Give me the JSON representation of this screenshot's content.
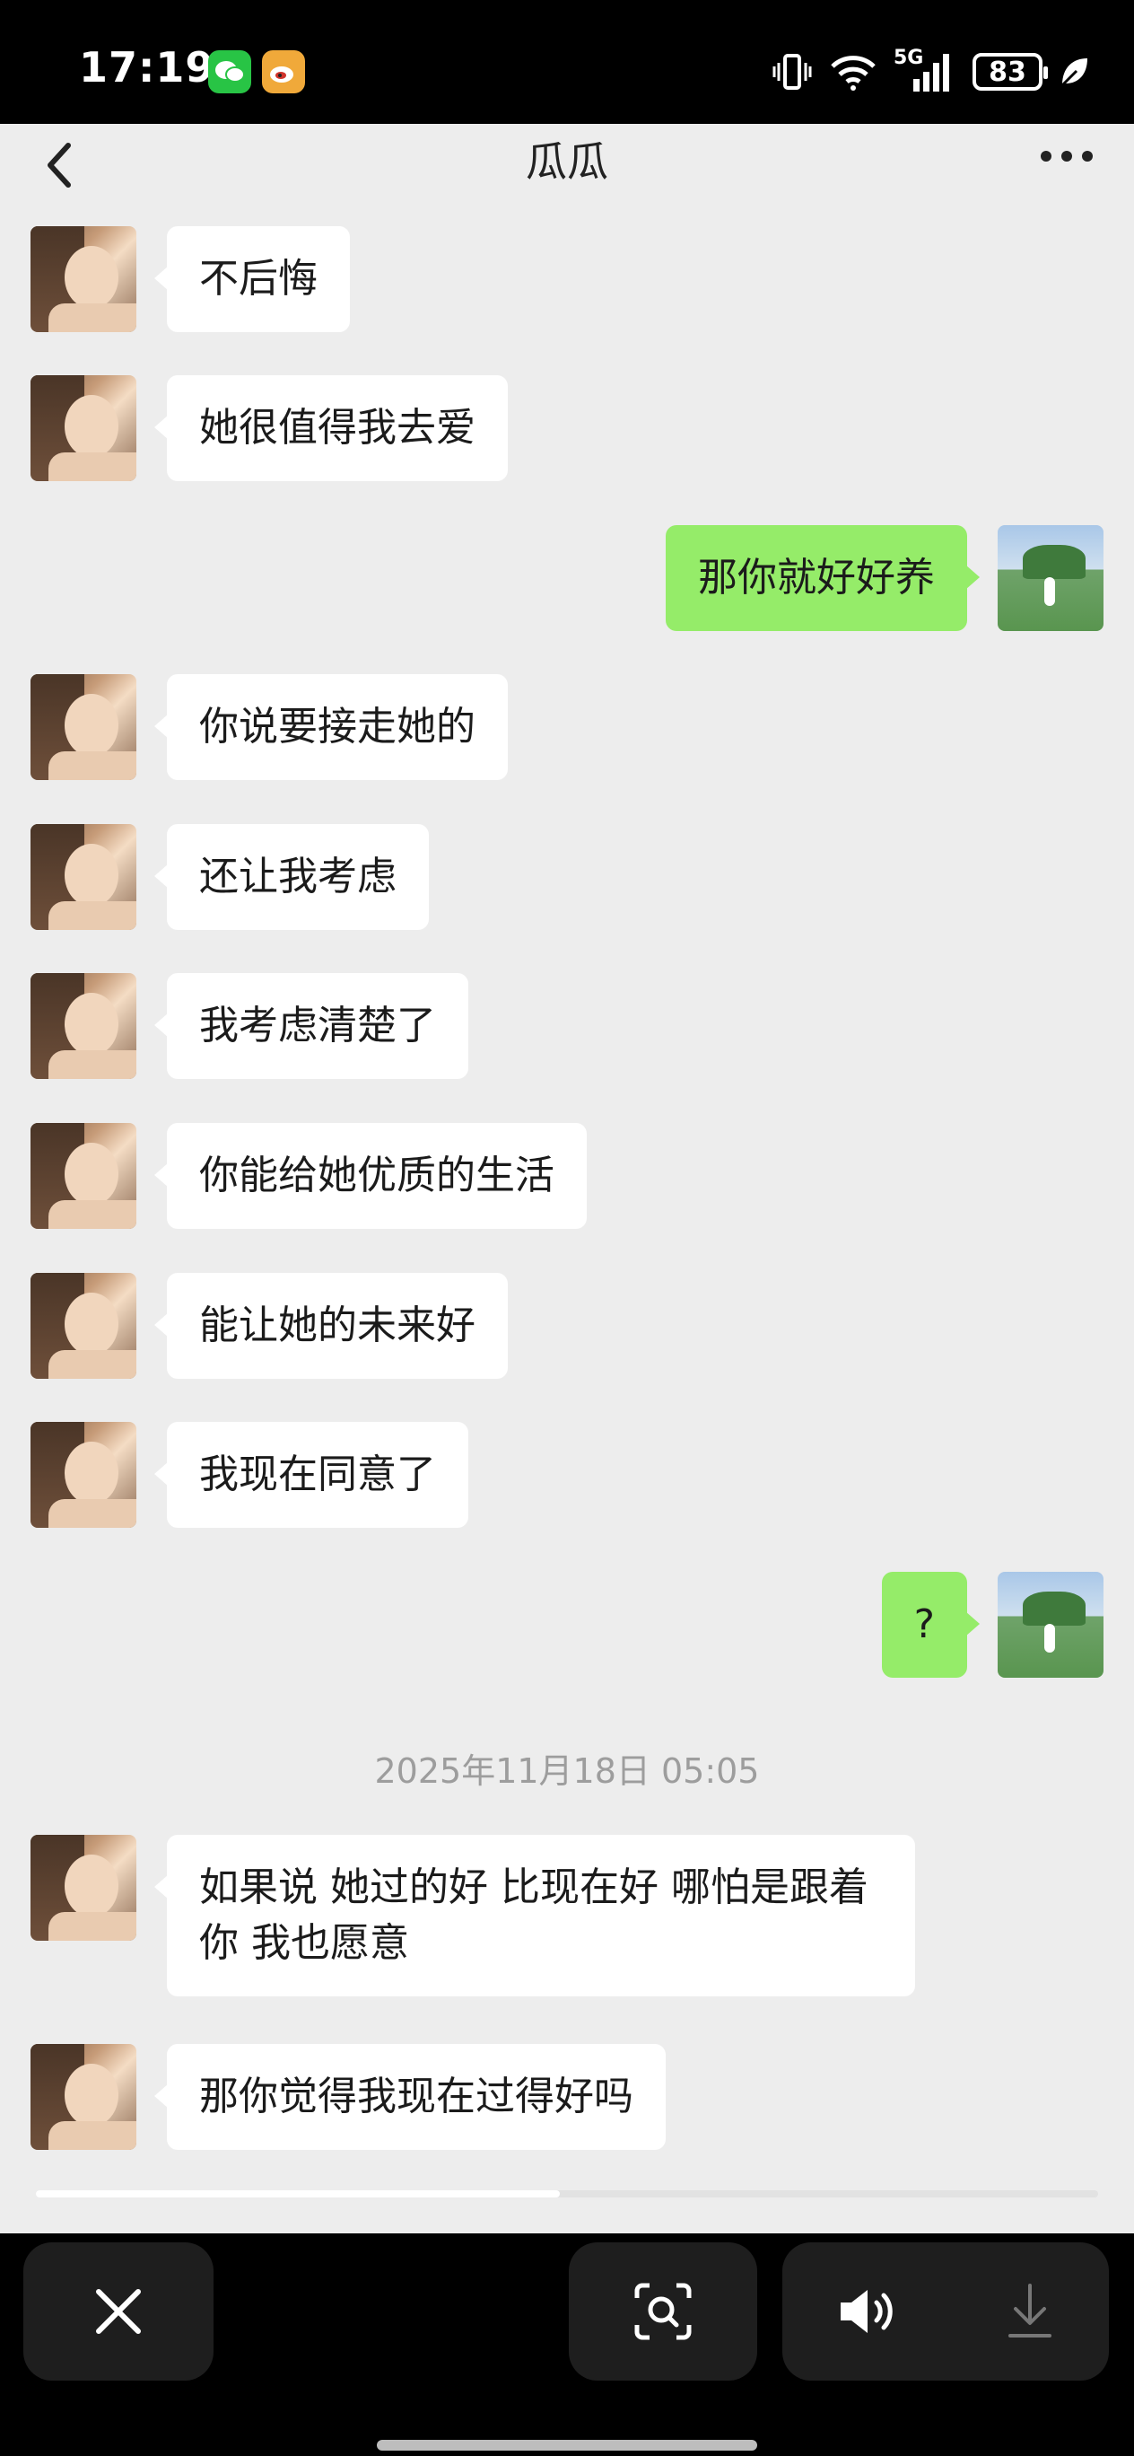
{
  "status_bar": {
    "time": "17:19",
    "network": "5G",
    "battery": "83",
    "apps": [
      "wechat-icon",
      "weibo-icon"
    ]
  },
  "header": {
    "title": "瓜瓜"
  },
  "colors": {
    "chat_background": "#ededed",
    "incoming_bubble": "#ffffff",
    "outgoing_bubble": "#95ec69",
    "toolbar_background": "#000000",
    "toolbar_button": "#1e1e1e"
  },
  "messages": [
    {
      "side": "left",
      "text": "不后悔"
    },
    {
      "side": "left",
      "text": "她很值得我去爱"
    },
    {
      "side": "right",
      "text": "那你就好好养"
    },
    {
      "side": "left",
      "text": "你说要接走她的"
    },
    {
      "side": "left",
      "text": "还让我考虑"
    },
    {
      "side": "left",
      "text": "我考虑清楚了"
    },
    {
      "side": "left",
      "text": "你能给她优质的生活"
    },
    {
      "side": "left",
      "text": "能让她的未来好"
    },
    {
      "side": "left",
      "text": "我现在同意了"
    },
    {
      "side": "right",
      "text": "?"
    },
    {
      "side": "left",
      "text": "如果说 她过的好 比现在好 哪怕是跟着你 我也愿意"
    },
    {
      "side": "left",
      "text": "那你觉得我现在过得好吗"
    }
  ],
  "timestamp": "2025年11月18日 05:05",
  "toolbar": {
    "buttons": [
      "close-icon",
      "scan-search-icon",
      "speaker-icon",
      "download-icon"
    ]
  }
}
